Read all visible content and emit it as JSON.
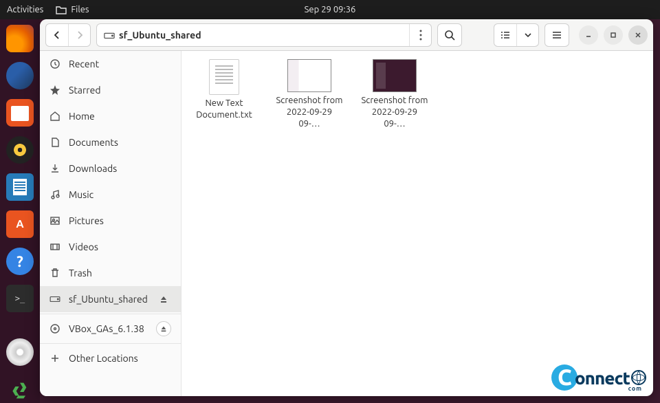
{
  "topbar": {
    "activities": "Activities",
    "app_label": "Files",
    "datetime": "Sep 29  09:36"
  },
  "window": {
    "path_label": "sf_Ubuntu_shared"
  },
  "sidebar": {
    "recent": "Recent",
    "starred": "Starred",
    "home": "Home",
    "documents": "Documents",
    "downloads": "Downloads",
    "music": "Music",
    "pictures": "Pictures",
    "videos": "Videos",
    "trash": "Trash",
    "shared": "sf_Ubuntu_shared",
    "vbox": "VBox_GAs_6.1.38",
    "other": "Other Locations"
  },
  "files": {
    "f1": "New Text Document.txt",
    "f2": "Screenshot from 2022-09-29 09-…",
    "f3": "Screenshot from 2022-09-29 09-…"
  },
  "watermark": {
    "text": "onnect",
    "sub": "com"
  }
}
